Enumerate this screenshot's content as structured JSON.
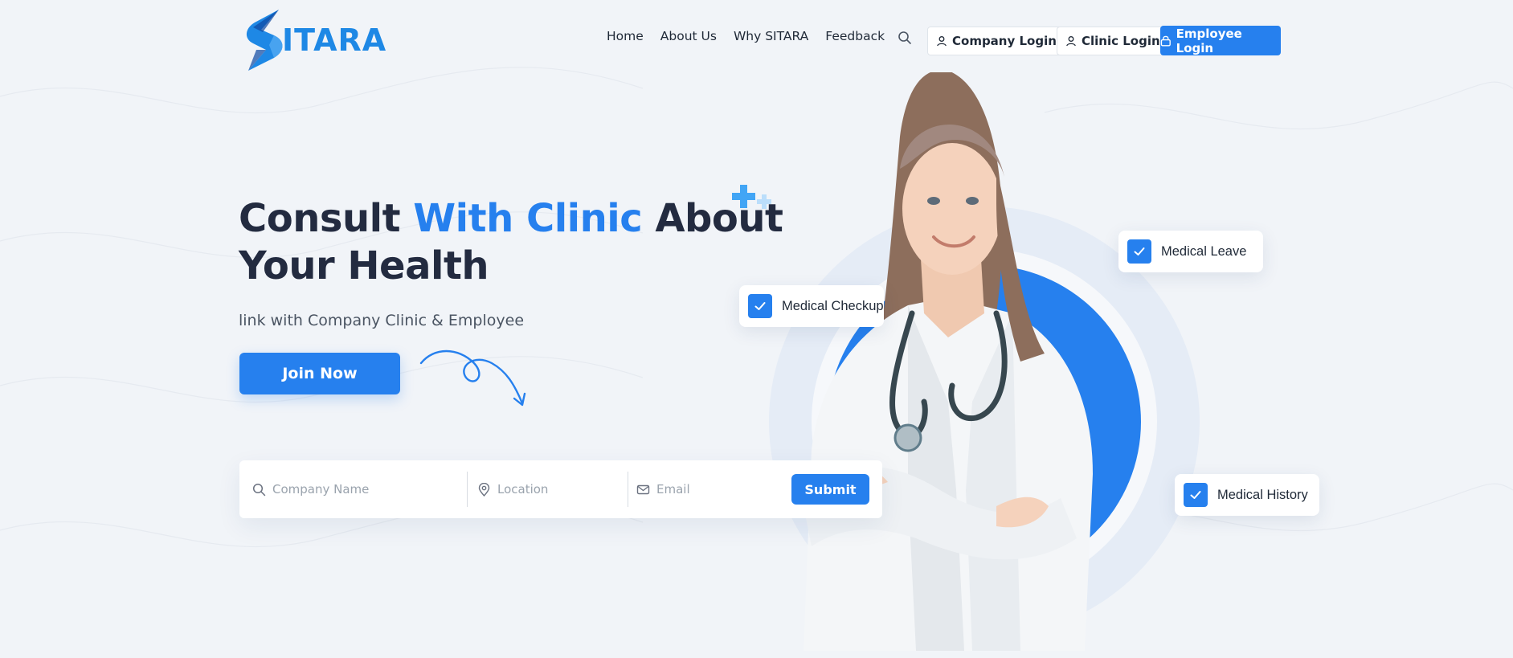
{
  "brand": {
    "name": "ITARA"
  },
  "nav": {
    "items": [
      "Home",
      "About Us",
      "Why SITARA",
      "Feedback"
    ]
  },
  "auth": {
    "company_login": "Company Login",
    "clinic_login": "Clinic Login",
    "employee_login": "Employee Login"
  },
  "hero": {
    "title_part1": "Consult ",
    "title_accent": "With Clinic",
    "title_part2": " About",
    "title_line2": "Your Health",
    "subtitle": "link with Company Clinic & Employee",
    "cta": "Join Now"
  },
  "form": {
    "company_placeholder": "Company Name",
    "location_placeholder": "Location",
    "email_placeholder": "Email",
    "submit": "Submit"
  },
  "badges": {
    "checkup": "Medical Checkup",
    "leave": "Medical Leave",
    "history": "Medical History"
  },
  "icons": [
    "search-icon",
    "user-icon",
    "lock-icon",
    "map-pin-icon",
    "mail-icon",
    "check-icon",
    "plus-icon"
  ],
  "colors": {
    "accent": "#2680ee",
    "dark": "#232b40",
    "background": "#f1f4f8"
  }
}
